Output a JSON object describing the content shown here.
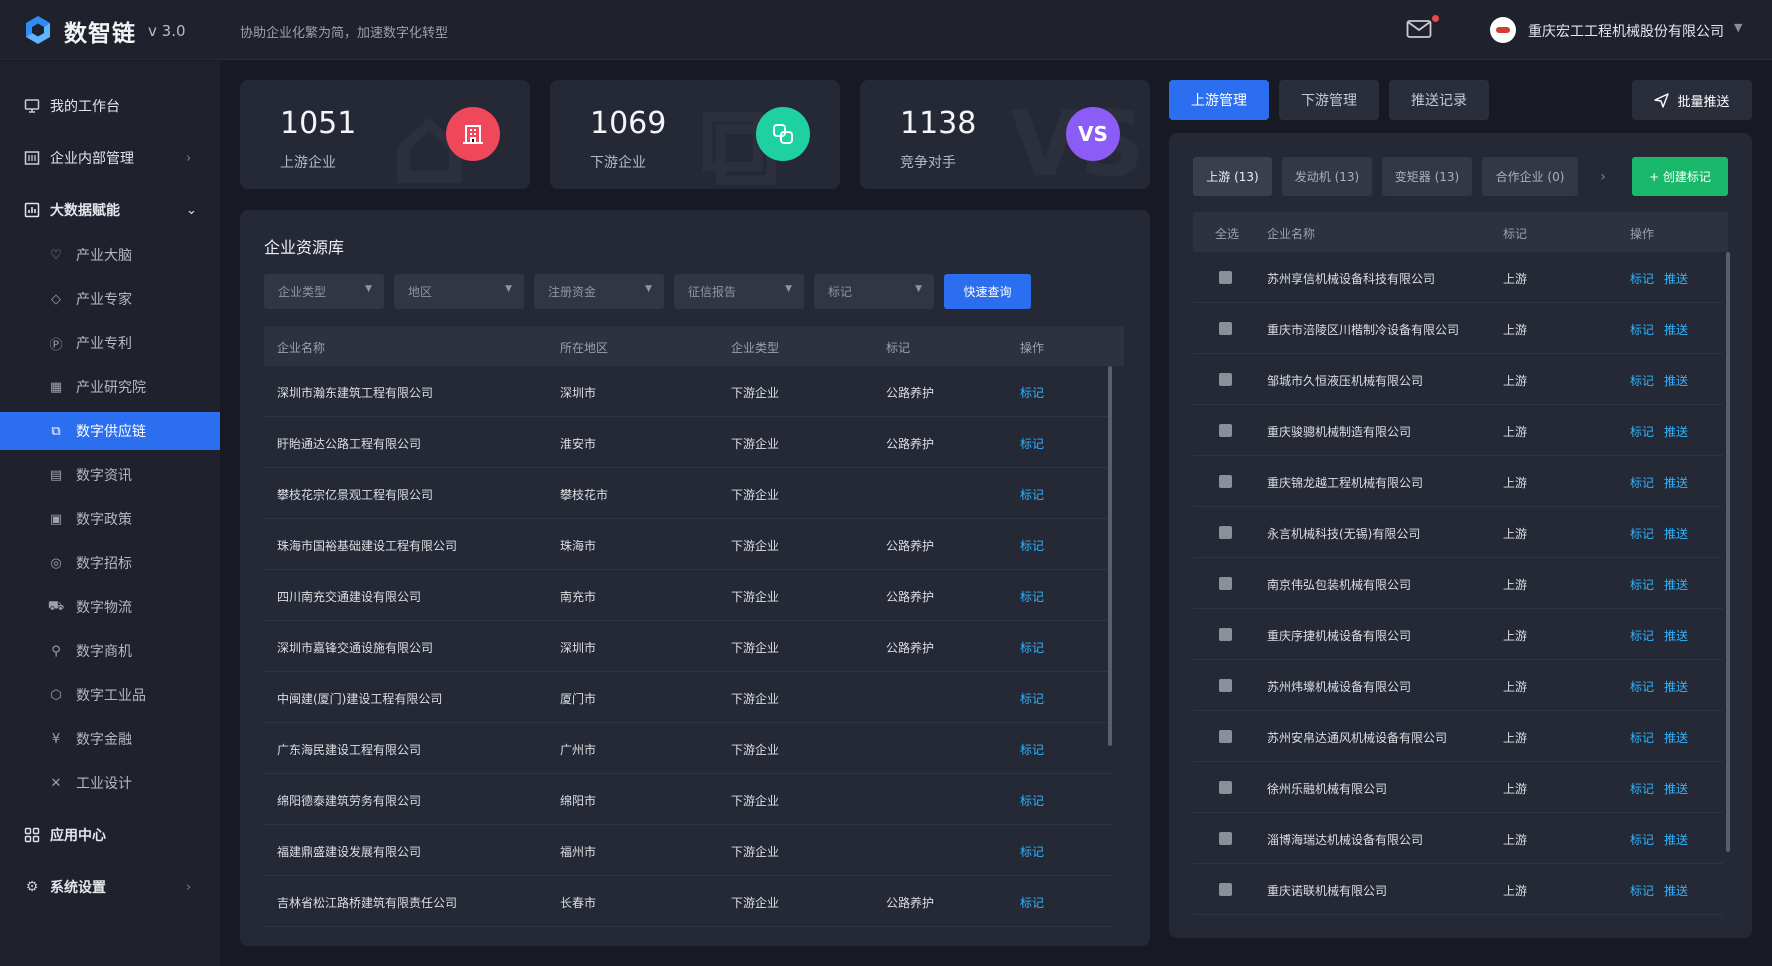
{
  "header": {
    "app_name": "数智链",
    "version": "v 3.0",
    "slogan": "协助企业化繁为简，加速数字化转型",
    "company": "重庆宏工工程机械股份有限公司"
  },
  "sidebar": {
    "items": [
      {
        "label": "我的工作台",
        "icon": "monitor-icon"
      },
      {
        "label": "企业内部管理",
        "icon": "building-icon"
      },
      {
        "label": "大数据赋能",
        "icon": "chart-icon"
      }
    ],
    "sub_items": [
      {
        "label": "产业大脑",
        "icon": "brain-icon"
      },
      {
        "label": "产业专家",
        "icon": "expert-icon"
      },
      {
        "label": "产业专利",
        "icon": "patent-icon"
      },
      {
        "label": "产业研究院",
        "icon": "institute-icon"
      },
      {
        "label": "数字供应链",
        "icon": "supply-chain-icon"
      },
      {
        "label": "数字资讯",
        "icon": "news-icon"
      },
      {
        "label": "数字政策",
        "icon": "policy-icon"
      },
      {
        "label": "数字招标",
        "icon": "bidding-icon"
      },
      {
        "label": "数字物流",
        "icon": "logistics-icon"
      },
      {
        "label": "数字商机",
        "icon": "opportunity-icon"
      },
      {
        "label": "数字工业品",
        "icon": "cube-icon"
      },
      {
        "label": "数字金融",
        "icon": "coin-icon"
      },
      {
        "label": "工业设计",
        "icon": "design-icon"
      }
    ],
    "bottom_items": [
      {
        "label": "应用中心",
        "icon": "apps-icon"
      },
      {
        "label": "系统设置",
        "icon": "gear-icon"
      }
    ]
  },
  "stats": [
    {
      "value": "1051",
      "label": "上游企业",
      "badge": ""
    },
    {
      "value": "1069",
      "label": "下游企业",
      "badge": ""
    },
    {
      "value": "1138",
      "label": "竞争对手",
      "badge": "VS"
    }
  ],
  "resource": {
    "title": "企业资源库",
    "filters": [
      "企业类型",
      "地区",
      "注册资金",
      "征信报告",
      "标记"
    ],
    "query_button": "快速查询",
    "columns": [
      "企业名称",
      "所在地区",
      "企业类型",
      "标记",
      "操作"
    ],
    "rows": [
      {
        "name": "深圳市瀚东建筑工程有限公司",
        "region": "深圳市",
        "type": "下游企业",
        "tag": "公路养护",
        "action": "标记"
      },
      {
        "name": "盱眙通达公路工程有限公司",
        "region": "淮安市",
        "type": "下游企业",
        "tag": "公路养护",
        "action": "标记"
      },
      {
        "name": "攀枝花宗亿景观工程有限公司",
        "region": "攀枝花市",
        "type": "下游企业",
        "tag": "",
        "action": "标记"
      },
      {
        "name": "珠海市国裕基础建设工程有限公司",
        "region": "珠海市",
        "type": "下游企业",
        "tag": "公路养护",
        "action": "标记"
      },
      {
        "name": "四川南充交通建设有限公司",
        "region": "南充市",
        "type": "下游企业",
        "tag": "公路养护",
        "action": "标记"
      },
      {
        "name": "深圳市嘉锋交通设施有限公司",
        "region": "深圳市",
        "type": "下游企业",
        "tag": "公路养护",
        "action": "标记"
      },
      {
        "name": "中闽建(厦门)建设工程有限公司",
        "region": "厦门市",
        "type": "下游企业",
        "tag": "",
        "action": "标记"
      },
      {
        "name": "广东海民建设工程有限公司",
        "region": "广州市",
        "type": "下游企业",
        "tag": "",
        "action": "标记"
      },
      {
        "name": "绵阳德泰建筑劳务有限公司",
        "region": "绵阳市",
        "type": "下游企业",
        "tag": "",
        "action": "标记"
      },
      {
        "name": "福建鼎盛建设发展有限公司",
        "region": "福州市",
        "type": "下游企业",
        "tag": "",
        "action": "标记"
      },
      {
        "name": "吉林省松江路桥建筑有限责任公司",
        "region": "长春市",
        "type": "下游企业",
        "tag": "公路养护",
        "action": "标记"
      }
    ]
  },
  "right": {
    "tabs": [
      "上游管理",
      "下游管理",
      "推送记录"
    ],
    "batch_push": "批量推送",
    "chips": [
      "上游 (13)",
      "发动机 (13)",
      "变矩器 (13)",
      "合作企业 (0)"
    ],
    "create_tag": "+ 创建标记",
    "columns": [
      "全选",
      "企业名称",
      "标记",
      "操作"
    ],
    "action_tag": "标记",
    "action_push": "推送",
    "rows": [
      {
        "name": "苏州享信机械设备科技有限公司",
        "tag": "上游"
      },
      {
        "name": "重庆市涪陵区川楷制冷设备有限公司",
        "tag": "上游"
      },
      {
        "name": "邹城市久恒液压机械有限公司",
        "tag": "上游"
      },
      {
        "name": "重庆骏骢机械制造有限公司",
        "tag": "上游"
      },
      {
        "name": "重庆锦龙越工程机械有限公司",
        "tag": "上游"
      },
      {
        "name": "永言机械科技(无锡)有限公司",
        "tag": "上游"
      },
      {
        "name": "南京伟弘包装机械有限公司",
        "tag": "上游"
      },
      {
        "name": "重庆序捷机械设备有限公司",
        "tag": "上游"
      },
      {
        "name": "苏州炜壕机械设备有限公司",
        "tag": "上游"
      },
      {
        "name": "苏州安帛达通风机械设备有限公司",
        "tag": "上游"
      },
      {
        "name": "徐州乐融机械有限公司",
        "tag": "上游"
      },
      {
        "name": "淄博海瑞达机械设备有限公司",
        "tag": "上游"
      },
      {
        "name": "重庆诺联机械有限公司",
        "tag": "上游"
      }
    ]
  },
  "colors": {
    "accent": "#2b6ff0",
    "green": "#19b86a",
    "link": "#2fb3ff",
    "badge_red": "#f0475a",
    "badge_green": "#1fd1a0",
    "badge_purple": "#8b5cf6"
  }
}
